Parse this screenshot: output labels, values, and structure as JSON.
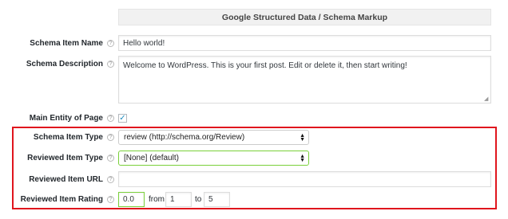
{
  "section": {
    "title": "Google Structured Data / Schema Markup"
  },
  "help_glyph": "?",
  "fields": {
    "item_name": {
      "label": "Schema Item Name",
      "value": "Hello world!"
    },
    "description": {
      "label": "Schema Description",
      "value": "Welcome to WordPress. This is your first post. Edit or delete it, then start writing!"
    },
    "main_entity": {
      "label": "Main Entity of Page",
      "checked_glyph": "✓"
    },
    "item_type": {
      "label": "Schema Item Type",
      "selected": "review (http://schema.org/Review)"
    },
    "reviewed_type": {
      "label": "Reviewed Item Type",
      "selected": "[None] (default)"
    },
    "reviewed_url": {
      "label": "Reviewed Item URL",
      "value": ""
    },
    "rating": {
      "label": "Reviewed Item Rating",
      "value": "0.0",
      "from_label": "from",
      "from_value": "1",
      "to_label": "to",
      "to_value": "5"
    }
  },
  "colors": {
    "highlight": "#e0161d",
    "valid": "#7ad03a",
    "check": "#1e8cbe"
  }
}
